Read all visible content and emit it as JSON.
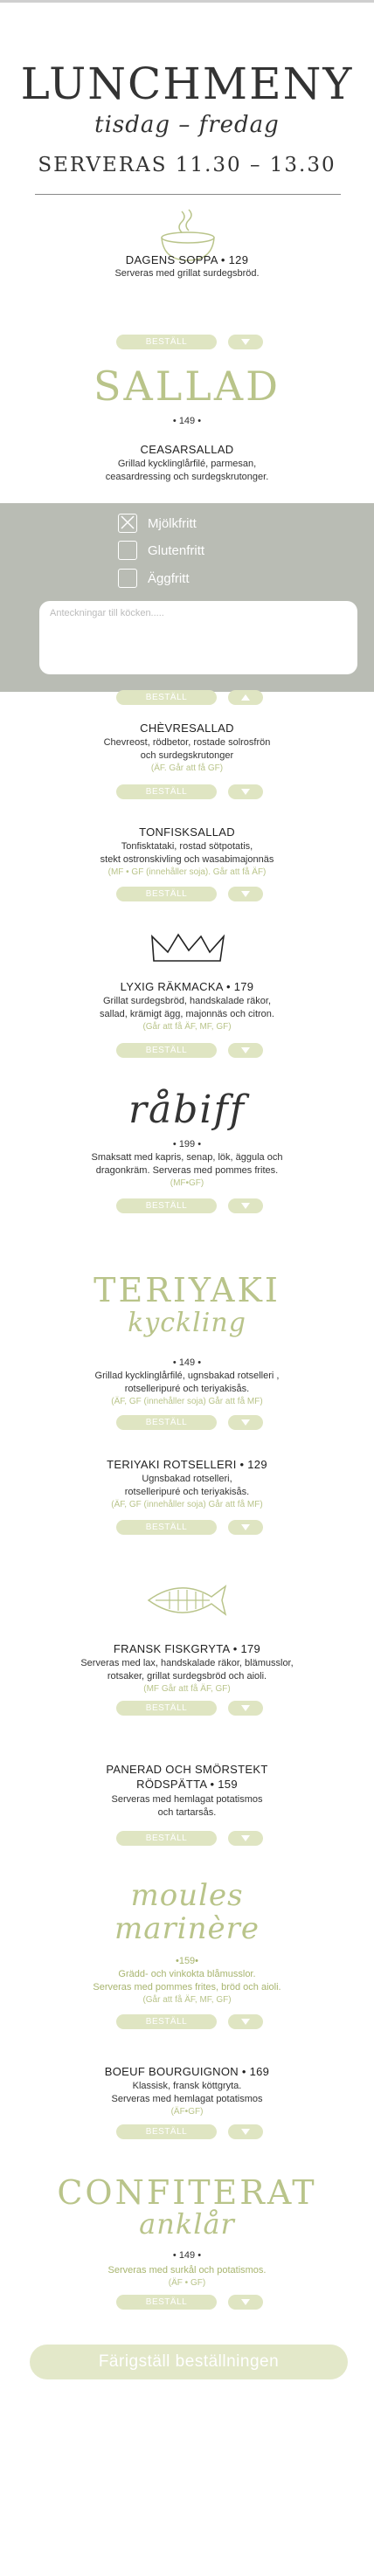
{
  "header": {
    "title": "LUNCHMENY",
    "days": "tisdag – fredag",
    "served": "SERVERAS 11.30 – 13.30"
  },
  "dagens": {
    "name": "DAGENS SOPPA • 129",
    "desc": "Serveras med grillat surdegsbröd."
  },
  "order_label": "BESTÄLL",
  "sallad": {
    "heading": "SALLAD",
    "price": "• 149 •"
  },
  "caesar": {
    "name": "CEASARSALLAD",
    "desc1": "Grillad kycklinglårfilé, parmesan,",
    "desc2": "ceasardressing och surdegskrutonger."
  },
  "options": {
    "milk": "Mjölkfritt",
    "gluten": "Glutenfritt",
    "egg": "Äggfritt",
    "notes_placeholder": "Anteckningar till köcken....."
  },
  "chevre": {
    "name": "CHÈVRESALLAD",
    "desc1": "Chevreost, rödbetor, rostade solrosfrön",
    "desc2": "och surdegskrutonger",
    "note": "(ÄF. Går att få GF)"
  },
  "tonfisk": {
    "name": "TONFISKSALLAD",
    "desc1": "Tonfisktataki, rostad sötpotatis,",
    "desc2": "stekt ostronskivling och wasabimajonnäs",
    "note": "(MF • GF (innehåller soja). Går att få ÄF)"
  },
  "lyxig": {
    "name": "LYXIG RÄKMACKA • 179",
    "desc1": "Grillat surdegsbröd, handskalade räkor,",
    "desc2": "sallad, krämigt ägg, majonnäs och citron.",
    "note": "(Går att få ÄF, MF, GF)"
  },
  "rabiff": {
    "heading": "råbiff",
    "price": "• 199 •",
    "desc1": "Smaksatt med kapris, senap, lök, äggula och",
    "desc2": "dragonkräm. Serveras med pommes frites.",
    "note": "(MF•GF)"
  },
  "teriyaki": {
    "heading1": "TERIYAKI",
    "heading2": "kyckling",
    "price": "• 149 •",
    "desc1": "Grillad kycklinglårfilé, ugnsbakad rotselleri ,",
    "desc2": "rotselleripuré och teriyakisås.",
    "note": "(ÄF, GF (innehåller soja) Går att få MF)"
  },
  "rotselleri": {
    "name": "TERIYAKI ROTSELLERI • 129",
    "desc1": "Ugnsbakad rotselleri,",
    "desc2": "rotselleripuré och teriyakisås.",
    "note": "(ÄF, GF (innehåller soja) Går att få MF)"
  },
  "fiskgryta": {
    "name": "FRANSK FISKGRYTA • 179",
    "desc1": "Serveras med lax, handskalade räkor, blämusslor,",
    "desc2": "rotsaker, grillat surdegsbröd och aioli.",
    "note": "(MF Går att få ÄF, GF)"
  },
  "rodspatta": {
    "name1": "PANERAD OCH SMÖRSTEKT",
    "name2": "RÖDSPÄTTA • 159",
    "desc1": "Serveras med hemlagat potatismos",
    "desc2": "och tartarsås."
  },
  "moules": {
    "heading1": "moules",
    "heading2": "marinère",
    "price": "•159•",
    "desc1": "Grädd- och vinkokta blåmusslor.",
    "desc2": "Serveras med pommes frites, bröd och aioli.",
    "note": "(Går att få ÄF, MF, GF)"
  },
  "boeuf": {
    "name": "BOEUF BOURGUIGNON • 169",
    "desc1": "Klassisk, fransk köttgryta.",
    "desc2": "Serveras med hemlagat potatismos",
    "note": "(ÄF•GF)"
  },
  "confit": {
    "heading1": "CONFITERAT",
    "heading2": "anklår",
    "price": "• 149 •",
    "desc": "Serveras med surkål och potatismos.",
    "note": "(ÄF • GF)"
  },
  "finish": "Färigställ beställningen"
}
